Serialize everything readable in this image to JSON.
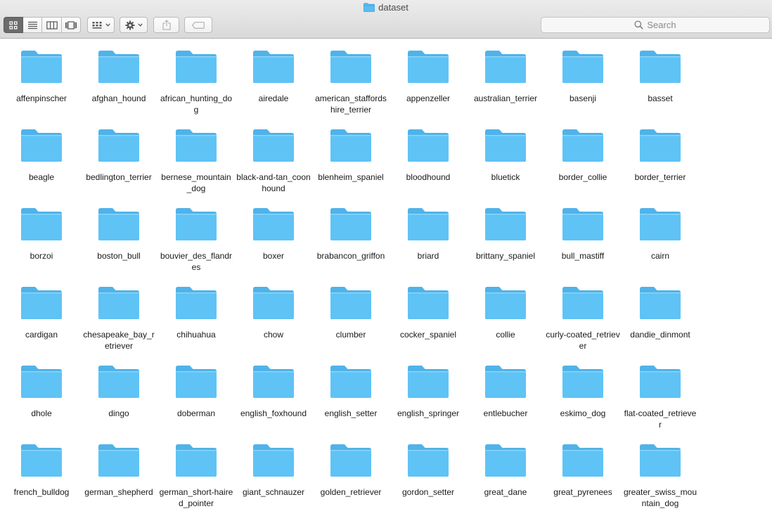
{
  "window": {
    "title": "dataset"
  },
  "toolbar": {
    "view_modes": [
      {
        "name": "icon-view",
        "icon": "grid-icon",
        "active": true
      },
      {
        "name": "list-view",
        "icon": "list-icon",
        "active": false
      },
      {
        "name": "column-view",
        "icon": "columns-icon",
        "active": false
      },
      {
        "name": "gallery-view",
        "icon": "gallery-icon",
        "active": false
      }
    ],
    "arrange_icon": "arrange-grid-icon",
    "action_icon": "gear-icon",
    "share_icon": "share-icon",
    "tags_icon": "tag-icon",
    "search_placeholder": "Search"
  },
  "colors": {
    "folder_body": "#5fc3f5",
    "folder_tab": "#4fb3ea",
    "active_segment": "#6b6b6b"
  },
  "folders": [
    "affenpinscher",
    "afghan_hound",
    "african_hunting_dog",
    "airedale",
    "american_staffordshire_terrier",
    "appenzeller",
    "australian_terrier",
    "basenji",
    "basset",
    "beagle",
    "bedlington_terrier",
    "bernese_mountain_dog",
    "black-and-tan_coonhound",
    "blenheim_spaniel",
    "bloodhound",
    "bluetick",
    "border_collie",
    "border_terrier",
    "borzoi",
    "boston_bull",
    "bouvier_des_flandres",
    "boxer",
    "brabancon_griffon",
    "briard",
    "brittany_spaniel",
    "bull_mastiff",
    "cairn",
    "cardigan",
    "chesapeake_bay_retriever",
    "chihuahua",
    "chow",
    "clumber",
    "cocker_spaniel",
    "collie",
    "curly-coated_retriever",
    "dandie_dinmont",
    "dhole",
    "dingo",
    "doberman",
    "english_foxhound",
    "english_setter",
    "english_springer",
    "entlebucher",
    "eskimo_dog",
    "flat-coated_retriever",
    "french_bulldog",
    "german_shepherd",
    "german_short-haired_pointer",
    "giant_schnauzer",
    "golden_retriever",
    "gordon_setter",
    "great_dane",
    "great_pyrenees",
    "greater_swiss_mountain_dog"
  ]
}
